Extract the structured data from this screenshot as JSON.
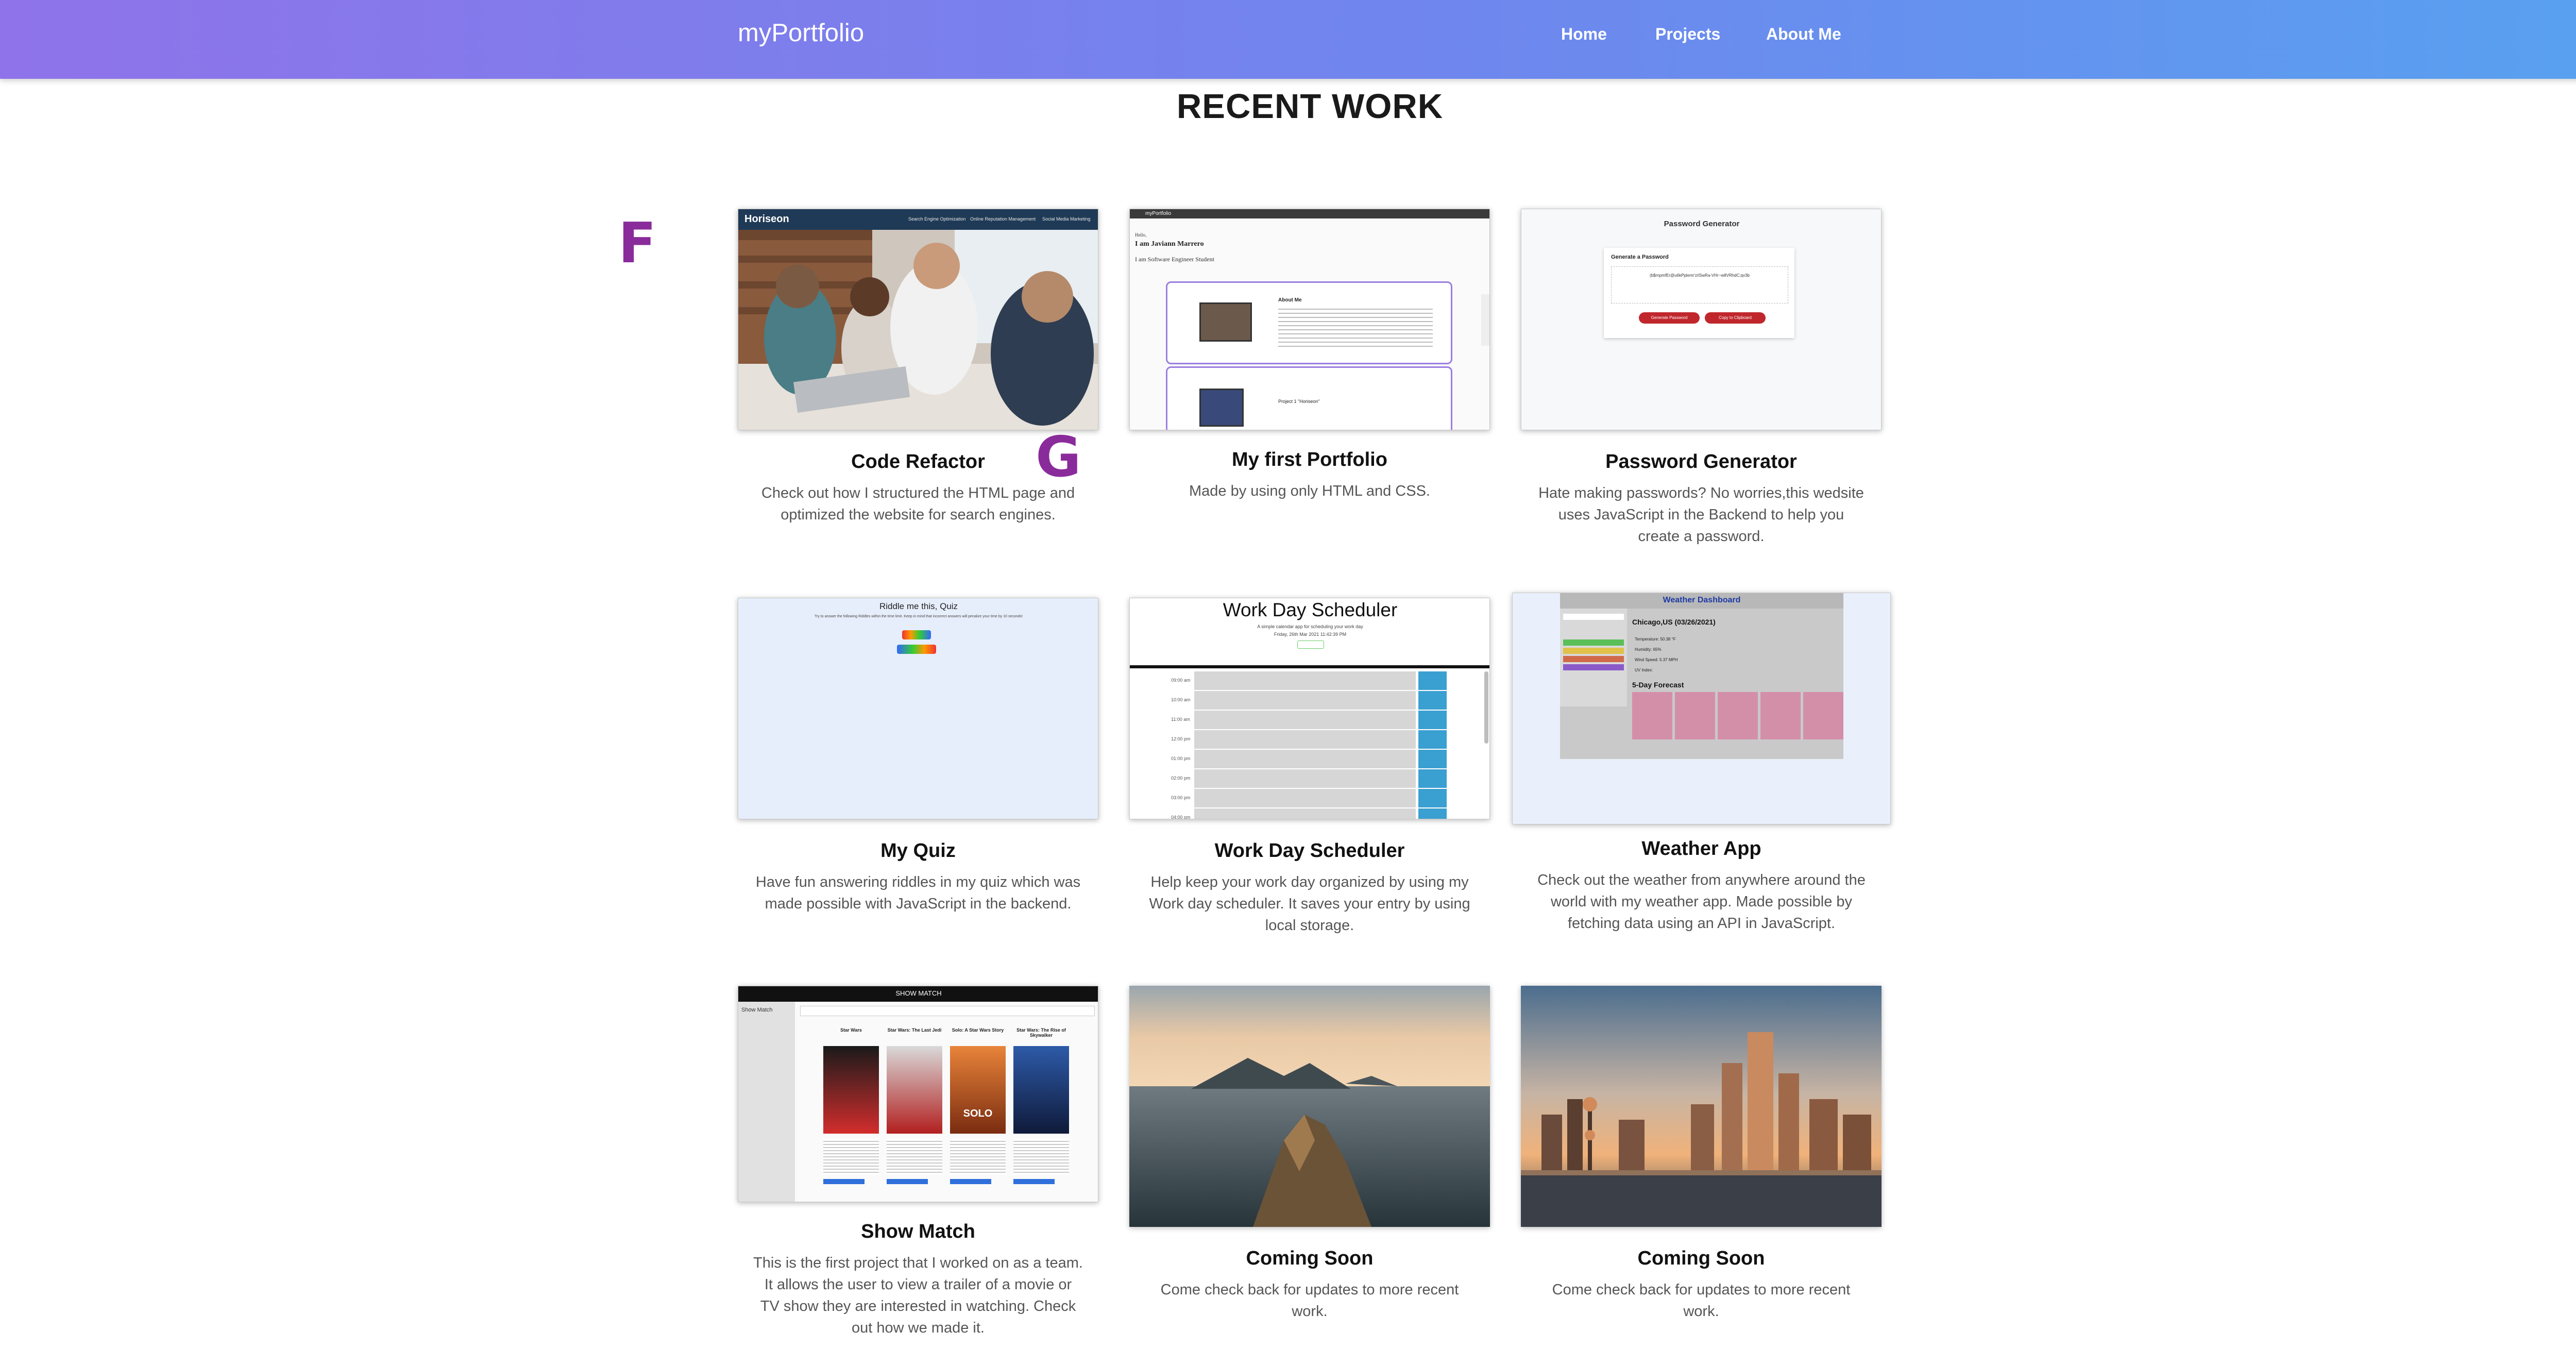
{
  "nav": {
    "brand": "myPortfolio",
    "links": [
      "Home",
      "Projects",
      "About Me"
    ]
  },
  "section_title": "RECENT WORK",
  "markers": [
    "F",
    "G"
  ],
  "projects": [
    {
      "title": "Code Refactor",
      "desc": "Check out how I structured the HTML page and optimized the website for search engines.",
      "thumb": {
        "site": "Horiseon",
        "menu": [
          "Search Engine Optimization",
          "Online Reputation Management",
          "Social Media Marketing"
        ]
      }
    },
    {
      "title": "My first Portfolio",
      "desc": "Made by using only HTML and CSS.",
      "thumb": {
        "brand": "myPortfolio",
        "greeting": "Hello,",
        "name": "I am Javiann Marrero",
        "role": "I am Software Engineer Student",
        "about": "About Me",
        "project": "Project 1 \"Horiseon\""
      }
    },
    {
      "title": "Password Generator",
      "desc": "Hate making passwords? No worries,this wedsite uses JavaScript in the Backend to help you create a password.",
      "thumb": {
        "header": "Password Generator",
        "card_title": "Generate a Password",
        "password": "(b$rnpmfEr@u6kPjdemr'z/iSwRa-VHr~w8VRhdC;qv3b",
        "btn1": "Generate Password",
        "btn2": "Copy to Clipboard"
      }
    },
    {
      "title": "My Quiz",
      "desc": "Have fun answering riddles in my quiz which was made possible with JavaScript in the backend.",
      "thumb": {
        "header": "Riddle me this, Quiz",
        "line": "Try to answer the following Riddles within the time limit. Keep in mind that incorrect answers will penalize your time by 10 seconds!"
      }
    },
    {
      "title": "Work Day Scheduler",
      "desc": "Help keep your work day organized by using my Work day scheduler. It saves your entry by using local storage.",
      "thumb": {
        "header": "Work Day Scheduler",
        "sub": "A simple calendar app for scheduling your work day",
        "date": "Friday, 26th Mar 2021 11:42:39 PM",
        "hours": [
          "09:00 am",
          "10:00 am",
          "11:00 am",
          "12:00 pm",
          "01:00 pm",
          "02:00 pm",
          "03:00 pm",
          "04:00 pm"
        ]
      }
    },
    {
      "title": "Weather App",
      "desc": "Check out the weather from anywhere around the world with my weather app. Made possible by fetching data using an API in JavaScript.",
      "thumb": {
        "header": "Weather Dashboard",
        "city": "Chicago,US (03/26/2021)",
        "temp": "Temperature: 50.38 °F",
        "humidity": "Humidity: 65%",
        "wind": "Wind Speed: 5.37 MPH",
        "uv": "UV Index:",
        "forecast": "5-Day Forecast"
      }
    },
    {
      "title": "Show Match",
      "desc": "This is the first project that I worked on as a team. It allows the user to view a trailer of a movie or TV show they are interested in watching. Check out how we made it.",
      "thumb": {
        "header": "SHOW MATCH",
        "side": "Show Match",
        "posters": [
          "Star Wars",
          "Star Wars: The Last Jedi",
          "Solo: A Star Wars Story",
          "Star Wars: The Rise of Skywalker"
        ],
        "solo": "SOLO"
      }
    },
    {
      "title": "Coming Soon",
      "desc": "Come check back for updates to more recent work."
    },
    {
      "title": "Coming Soon",
      "desc": "Come check back for updates to more recent work."
    }
  ],
  "colors": {
    "nav_start": "#8f73ea",
    "nav_end": "#58a1f0",
    "marker": "#8a2b9b",
    "red_button": "#c0272d",
    "schedule_save": "#3a9fd1",
    "forecast_card": "#d48fa8"
  }
}
